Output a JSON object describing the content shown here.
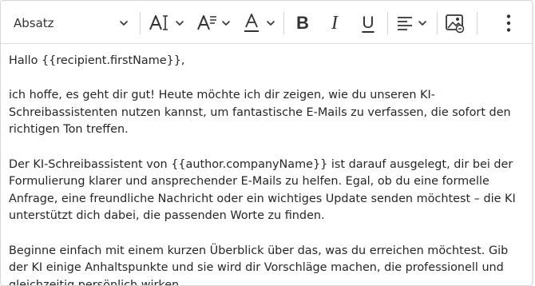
{
  "toolbar": {
    "block_format": "Absatz",
    "icons": [
      "text-size-icon",
      "line-height-icon",
      "text-color-icon",
      "bold-icon",
      "italic-icon",
      "underline-icon",
      "align-icon",
      "image-icon",
      "more-icon"
    ],
    "bold_label": "B",
    "italic_label": "I",
    "underline_label": "U"
  },
  "editor": {
    "paragraphs": [
      "Hallo {{recipient.firstName}},",
      "ich hoffe, es geht dir gut! Heute möchte ich dir zeigen, wie du unseren KI-Schreibassistenten nutzen kannst, um fantastische E-Mails zu verfassen, die sofort den richtigen Ton treffen.",
      "Der KI-Schreibassistent von {{author.companyName}} ist darauf ausgelegt, dir bei der Formulierung klarer und ansprechender E-Mails zu helfen. Egal, ob du eine formelle Anfrage, eine freundliche Nachricht oder ein wichtiges Update senden möchtest – die KI unterstützt dich dabei, die passenden Worte zu finden.",
      "Beginne einfach mit einem kurzen Überblick über das, was du erreichen möchtest. Gib der KI einige Anhaltspunkte und sie wird dir Vorschläge machen, die professionell und gleichzeitig persönlich wirken."
    ]
  },
  "colors": {
    "border": "#d4d6da",
    "text": "#262626",
    "icon": "#333333"
  }
}
